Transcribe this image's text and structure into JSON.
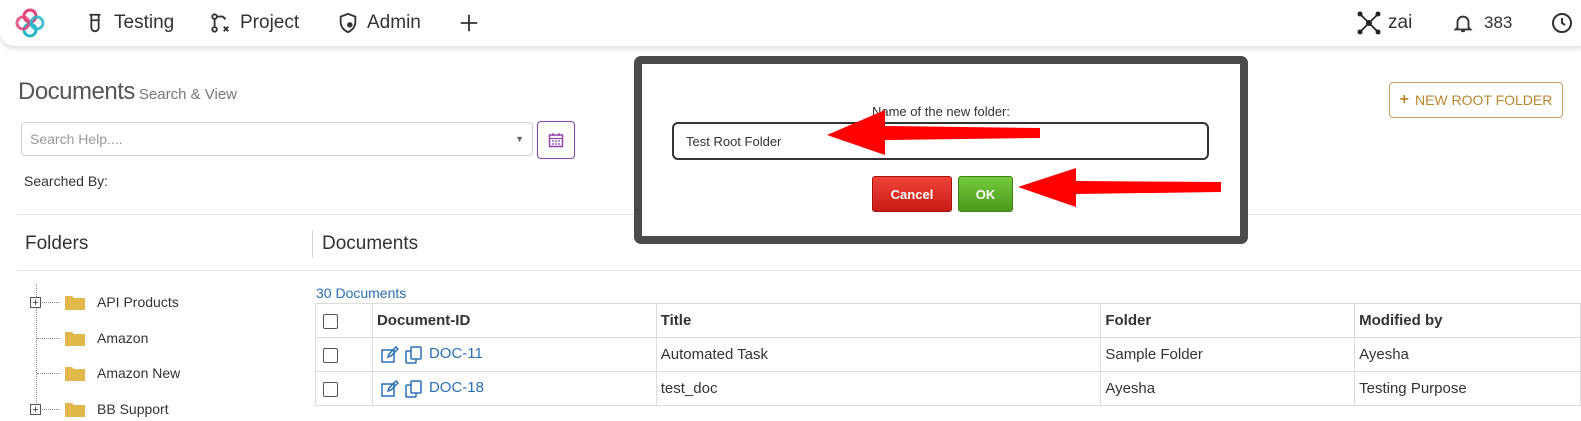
{
  "nav": {
    "items": [
      {
        "label": "Testing",
        "icon": "test-tube-icon"
      },
      {
        "label": "Project",
        "icon": "project-icon"
      },
      {
        "label": "Admin",
        "icon": "admin-shield-icon"
      }
    ],
    "add_icon": "plus-icon",
    "zai_label": "zai",
    "notifications_count": "383"
  },
  "page": {
    "title": "Documents",
    "subtitle": "Search & View",
    "search_placeholder": "Search Help....",
    "searched_by_label": "Searched By:",
    "new_root_folder_label": "NEW ROOT FOLDER"
  },
  "folders": {
    "title": "Folders",
    "items": [
      {
        "name": "API Products",
        "expandable": true
      },
      {
        "name": "Amazon",
        "expandable": false
      },
      {
        "name": "Amazon New",
        "expandable": false
      },
      {
        "name": "BB Support",
        "expandable": true
      }
    ]
  },
  "documents": {
    "title": "Documents",
    "count_label": "30 Documents",
    "columns": [
      "Document-ID",
      "Title",
      "Folder",
      "Modified by"
    ],
    "rows": [
      {
        "id": "DOC-11",
        "title": "Automated Task",
        "folder": "Sample Folder",
        "modified_by": "Ayesha"
      },
      {
        "id": "DOC-18",
        "title": "test_doc",
        "folder": "Ayesha",
        "modified_by": "Testing Purpose"
      }
    ]
  },
  "dialog": {
    "label": "Name of the new folder:",
    "input_value": "Test Root Folder",
    "cancel_label": "Cancel",
    "ok_label": "OK"
  },
  "colors": {
    "accent_purple": "#8e44ad",
    "link_blue": "#2a6fb3",
    "gold": "#b8862f",
    "cancel_red": "#d9251c",
    "ok_green": "#5aab28",
    "annotation_red": "#ff0000"
  }
}
